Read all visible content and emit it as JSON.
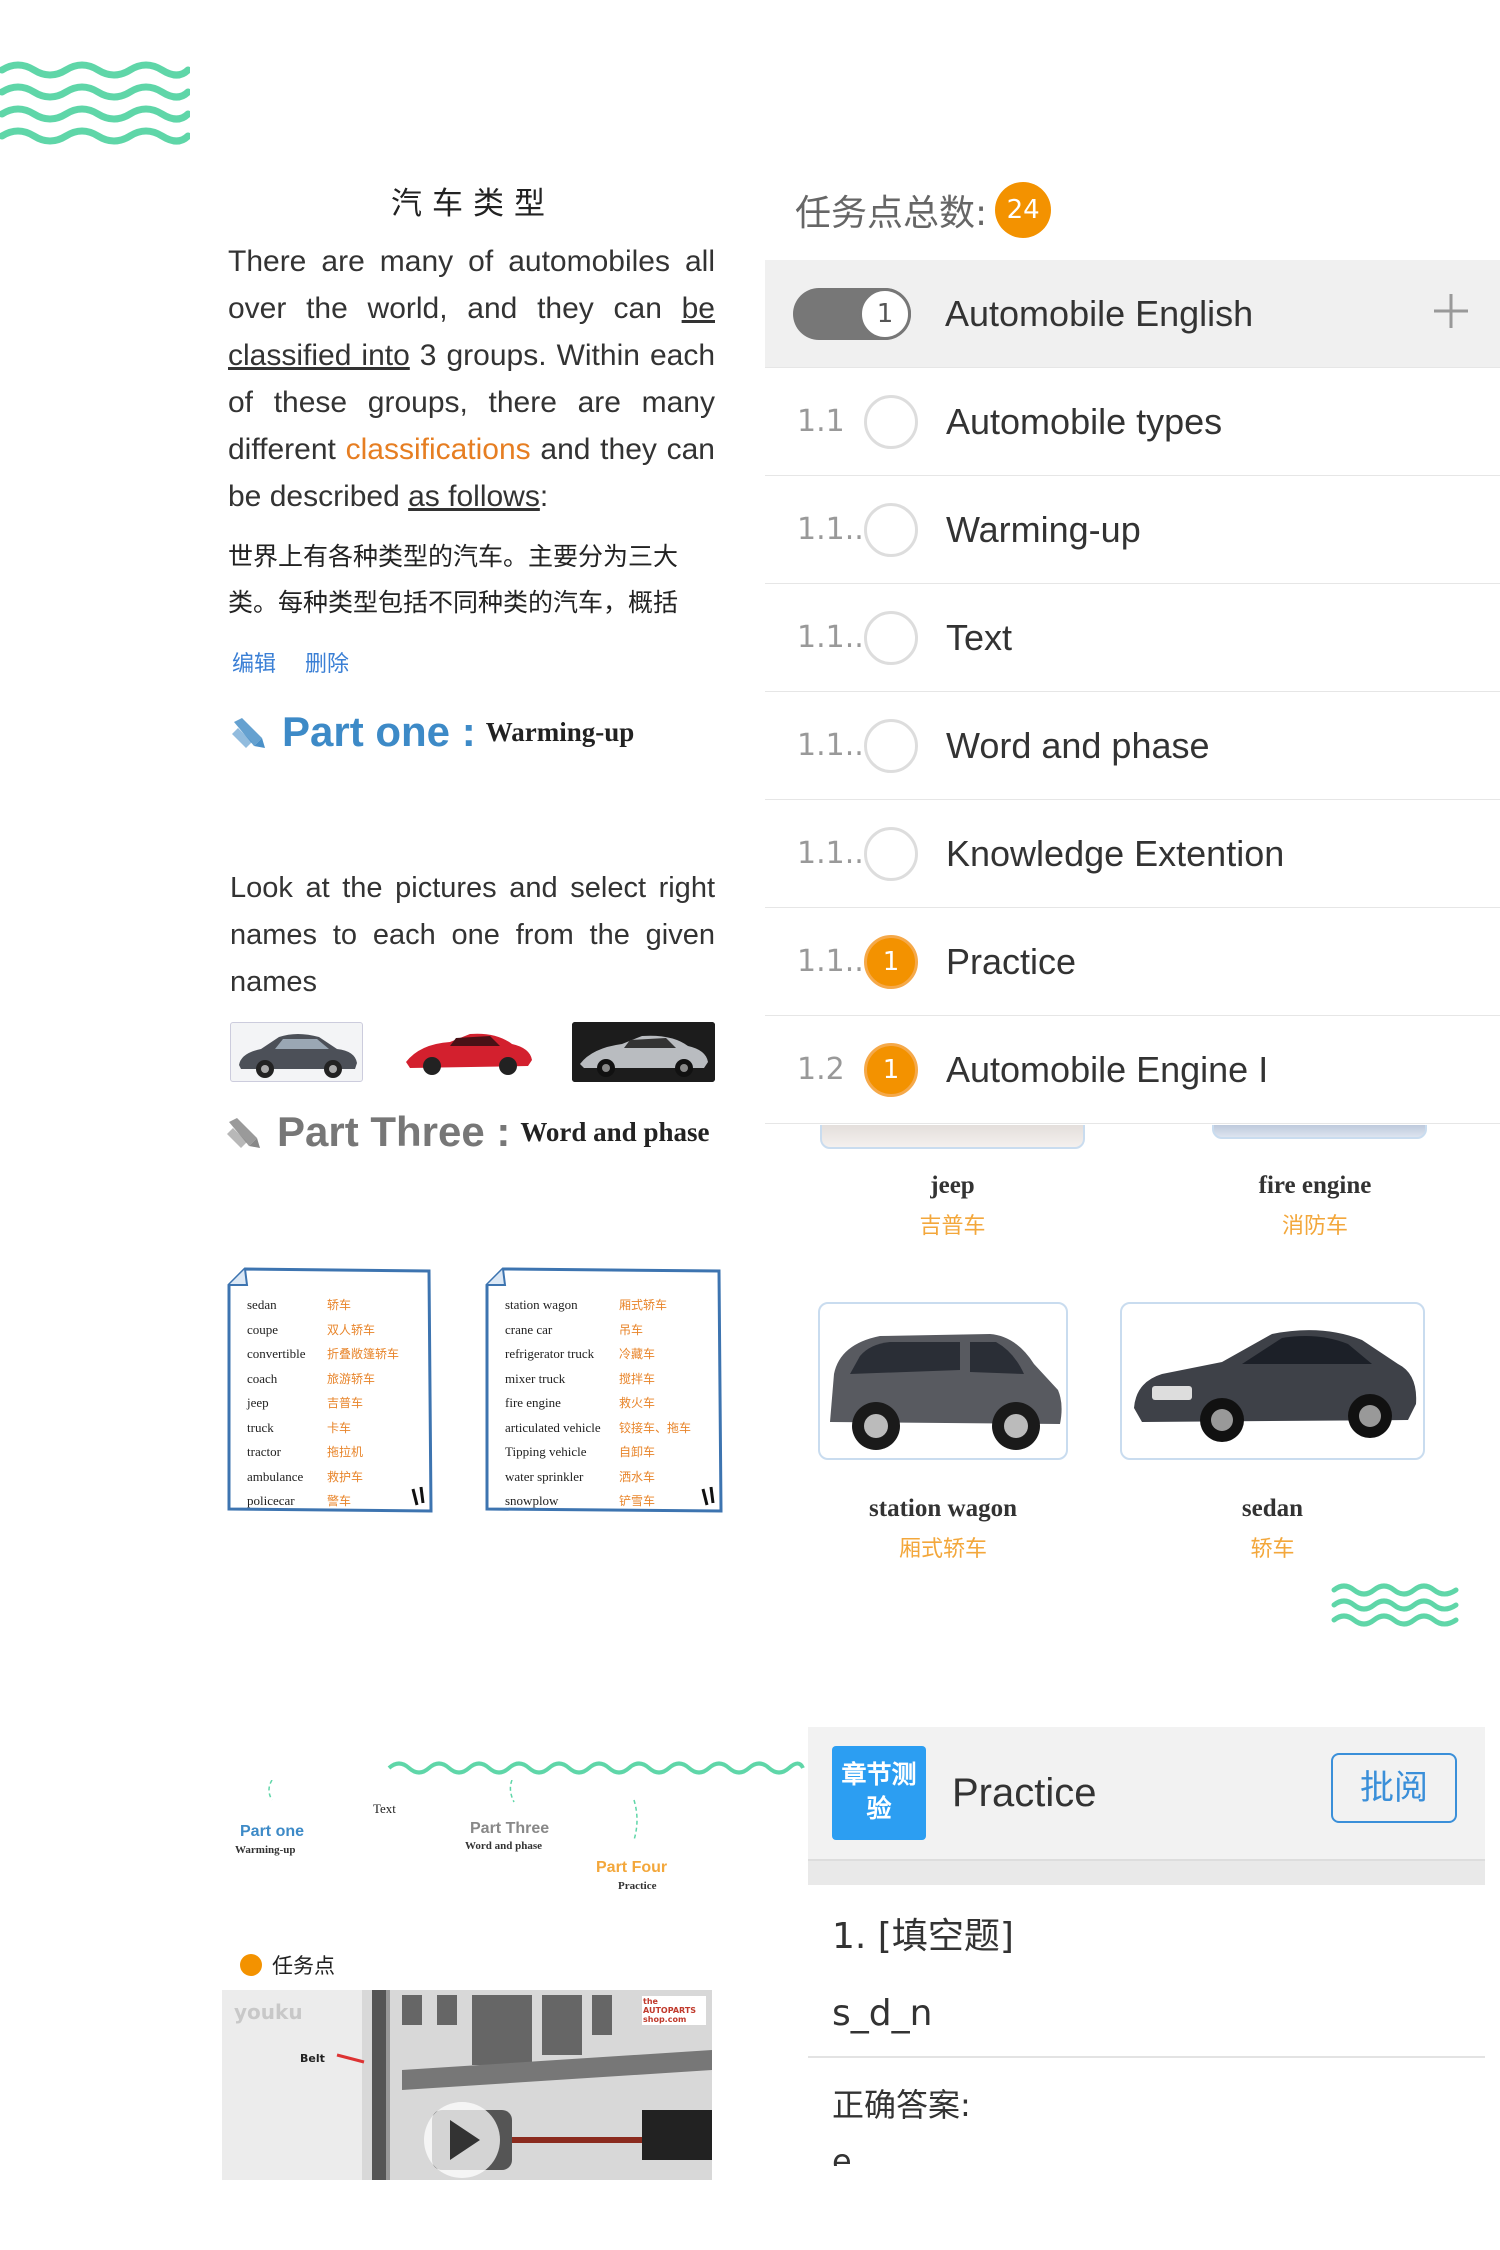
{
  "article": {
    "title": "汽车类型",
    "p1_a": "There are many of automobiles all over the world, and they can ",
    "p1_link1": "be classified into",
    "p1_b": " 3 groups. Within each of these groups, there are many different ",
    "p1_highlight": "classifications",
    "p1_c": " and they can be described ",
    "p1_link2": "as follows",
    "p1_d": ":",
    "zh": "世界上有各种类型的汽车。主要分为三大类。每种类型包括不同种类的汽车，概括",
    "edit": "编辑",
    "delete": "删除"
  },
  "part_one": {
    "label": "Part one :",
    "sub": "Warming-up"
  },
  "look": "Look at the pictures and select right names to each one from the given names",
  "part_three": {
    "label": "Part Three :",
    "sub": "Word and phase"
  },
  "note1": [
    {
      "en": "sedan",
      "cn": "轿车"
    },
    {
      "en": "coupe",
      "cn": "双人轿车"
    },
    {
      "en": "convertible",
      "cn": "折叠敞篷轿车"
    },
    {
      "en": "coach",
      "cn": "旅游轿车"
    },
    {
      "en": "jeep",
      "cn": "吉普车"
    },
    {
      "en": "truck",
      "cn": "卡车"
    },
    {
      "en": "tractor",
      "cn": "拖拉机"
    },
    {
      "en": "ambulance",
      "cn": "救护车"
    },
    {
      "en": "policecar",
      "cn": "警车"
    }
  ],
  "note2": [
    {
      "en": "station wagon",
      "cn": "厢式轿车"
    },
    {
      "en": "crane car",
      "cn": "吊车"
    },
    {
      "en": "refrigerator truck",
      "cn": "冷藏车"
    },
    {
      "en": "mixer truck",
      "cn": "搅拌车"
    },
    {
      "en": "fire engine",
      "cn": "救火车"
    },
    {
      "en": "articulated vehicle",
      "cn": "铰接车、拖车"
    },
    {
      "en": "Tipping vehicle",
      "cn": "自卸车"
    },
    {
      "en": "water sprinkler",
      "cn": "洒水车"
    },
    {
      "en": "snowplow",
      "cn": "铲雪车"
    }
  ],
  "course": {
    "task_total_label": "任务点总数:",
    "task_total": "24",
    "chapters": [
      {
        "num": "",
        "badge": "1",
        "label": "Automobile English"
      },
      {
        "num": "1.1",
        "badge": "",
        "label": "Automobile types"
      },
      {
        "num": "1.1...",
        "badge": "",
        "label": "Warming-up"
      },
      {
        "num": "1.1...",
        "badge": "",
        "label": "Text"
      },
      {
        "num": "1.1...",
        "badge": "",
        "label": "Word and phase"
      },
      {
        "num": "1.1...",
        "badge": "",
        "label": "Knowledge Extention"
      },
      {
        "num": "1.1...",
        "badge": "1",
        "label": "Practice"
      },
      {
        "num": "1.2",
        "badge": "1",
        "label": "Automobile Engine I"
      }
    ]
  },
  "vehicles": [
    {
      "en": "jeep",
      "cn": "吉普车"
    },
    {
      "en": "fire engine",
      "cn": "消防车"
    },
    {
      "en": "station wagon",
      "cn": "厢式轿车"
    },
    {
      "en": "sedan",
      "cn": "轿车"
    }
  ],
  "mindmap": {
    "text": "Text",
    "part_one": "Part one",
    "part_one_sub": "Warming-up",
    "part_three": "Part Three",
    "part_three_sub": "Word and phase",
    "part_four": "Part Four",
    "part_four_sub": "Practice"
  },
  "task_point": "任务点",
  "video": {
    "brand": "youku",
    "belt": "Belt",
    "logo": "the AUTOPARTS shop.com"
  },
  "practice": {
    "tag": "章节测验",
    "title": "Practice",
    "review": "批阅",
    "question": "1. [填空题]",
    "answer": "s_d_n",
    "correct_label": "正确答案:",
    "correct_value": "e"
  },
  "colors": {
    "accent_orange": "#f39200",
    "accent_blue": "#3d8ac7",
    "wave": "#5fd6a8"
  }
}
